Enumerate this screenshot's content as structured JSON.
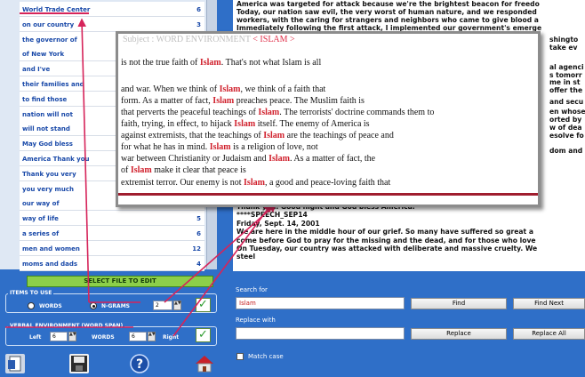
{
  "list": {
    "rows": [
      {
        "text": "World Trade Center",
        "count": "6"
      },
      {
        "text": "on our country",
        "count": "3"
      },
      {
        "text": "the governor of",
        "count": ""
      },
      {
        "text": "of New York",
        "count": ""
      },
      {
        "text": "and I've",
        "count": ""
      },
      {
        "text": "their families and",
        "count": ""
      },
      {
        "text": "to find those",
        "count": ""
      },
      {
        "text": "nation will not",
        "count": ""
      },
      {
        "text": "will not stand",
        "count": ""
      },
      {
        "text": "May God bless",
        "count": ""
      },
      {
        "text": "America Thank you",
        "count": ""
      },
      {
        "text": "Thank you very",
        "count": ""
      },
      {
        "text": "you very much",
        "count": ""
      },
      {
        "text": "our way of",
        "count": ""
      },
      {
        "text": "way of life",
        "count": "5"
      },
      {
        "text": "a series of",
        "count": "6"
      },
      {
        "text": "men and women",
        "count": "12"
      },
      {
        "text": "moms and dads",
        "count": "4"
      }
    ]
  },
  "controls": {
    "select_label": "SELECT FILE TO EDIT",
    "items_title": "ITEMS TO USE",
    "words_label": "WORDS",
    "ngrams_label": "N-GRAMS",
    "ngram_value": "2",
    "env_title": "VERBAL ENVIRONMENT (WORD SPAN)",
    "left_label": "Left",
    "left_value": "6",
    "words_mid": "WORDS",
    "right_value": "6",
    "right_label": "Right"
  },
  "speech": {
    "top_lines": [
      "America was targeted for attack because we're the brightest beacon for freedo",
      "Today, our nation saw evil, the very worst of human nature, and we responded",
      "workers, with the caring for strangers and neighbors who came to give blood a",
      "Immediately following the first attack, I implemented our government's emerge"
    ],
    "side_fragments": [
      "shingto",
      "take ev",
      "al agenci",
      "s tomorr",
      "me in st",
      "offer the",
      "and secu",
      "en whose",
      "orted by",
      "w of dea",
      "esolve fo",
      "dom and"
    ],
    "bottom_lines": [
      "Thank you. Good night and God bless America.",
      "****SPEECH_SEP14",
      "Friday, Sept. 14, 2001",
      "We are here in the middle hour of our grief. So many have suffered so great a",
      "come before God to pray for the missing and the dead, and for those who love",
      "On Tuesday, our country was attacked with deliberate and massive cruelty. We",
      "steel"
    ]
  },
  "search": {
    "search_label": "Search for",
    "search_value": "Islam",
    "find_label": "Find",
    "find_next_label": "Find Next",
    "replace_label": "Replace with",
    "replace_value": "",
    "replace_btn": "Replace",
    "replace_all_btn": "Replace All",
    "match_case_label": "Match case"
  },
  "popup": {
    "subject_prefix": "Subject : WORD ENVIRONMENT",
    "subject_keyword": "< ISLAM >",
    "lines": [
      [
        "is not the true faith of ",
        "Islam",
        ". That's not what Islam is all"
      ],
      [
        "",
        "",
        ""
      ],
      [
        "and war. When we think of ",
        "Islam",
        ", we think of a faith that"
      ],
      [
        "form. As a matter of fact, ",
        "Islam",
        " preaches peace. The Muslim faith is"
      ],
      [
        "that perverts the peaceful teachings of ",
        "Islam",
        ". The terrorists' doctrine commands them to"
      ],
      [
        "faith, trying, in effect, to hijack ",
        "Islam",
        " itself. The enemy of America is"
      ],
      [
        "against extremists, that the teachings of ",
        "Islam",
        " are the teachings of peace and"
      ],
      [
        "for what he has in mind. ",
        "Islam",
        " is a religion of love, not"
      ],
      [
        "war between Christianity or Judaism and ",
        "Islam",
        ". As a matter of fact, the"
      ],
      [
        "of ",
        "Islam",
        " make it clear that peace is"
      ],
      [
        "extremist terror. Our enemy is not ",
        "Islam",
        ", a good and peace-loving faith that"
      ]
    ]
  },
  "colors": {
    "background": "#2f6fc8",
    "highlight": "#d0202c",
    "arrow": "#d6245a"
  }
}
